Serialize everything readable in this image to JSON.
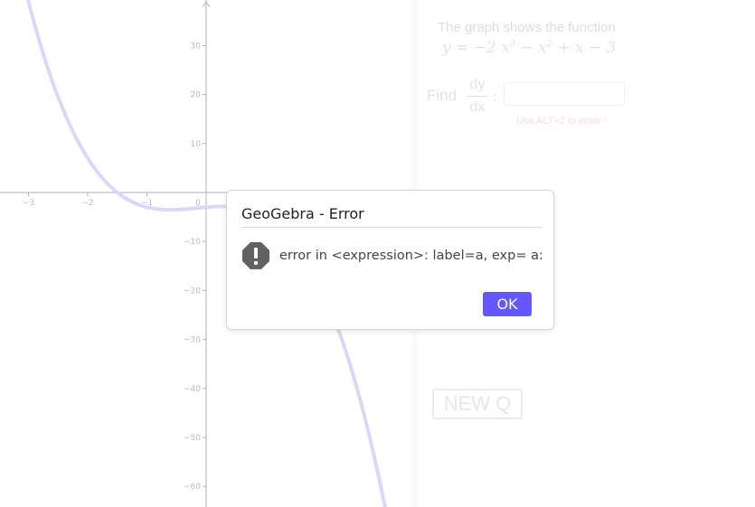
{
  "graph": {
    "x_ticks": [
      "−3",
      "−2",
      "−1",
      "0"
    ],
    "y_ticks": [
      "30",
      "20",
      "10",
      "−10",
      "−20",
      "−30",
      "−40",
      "−50",
      "−60"
    ],
    "function_coeffs": {
      "a3": -2,
      "a2": -1,
      "a1": 1,
      "a0": -3
    },
    "curve_color": "#a8a8f8"
  },
  "question": {
    "caption": "The graph shows the function",
    "formula_parts": [
      "y = −2 x",
      "3",
      " − x",
      "2",
      " + x − 3"
    ],
    "find_label": "Find",
    "frac_num": "dy",
    "frac_den": "dx",
    "colon": ":",
    "answer_value": "",
    "hint": "Use ALT+2 to enter ²",
    "new_q_label": "NEW Q"
  },
  "dialog": {
    "title": "GeoGebra - Error",
    "message": "error in <expression>: label=a, exp= a:",
    "ok_label": "OK",
    "accent": "#6557ff"
  }
}
